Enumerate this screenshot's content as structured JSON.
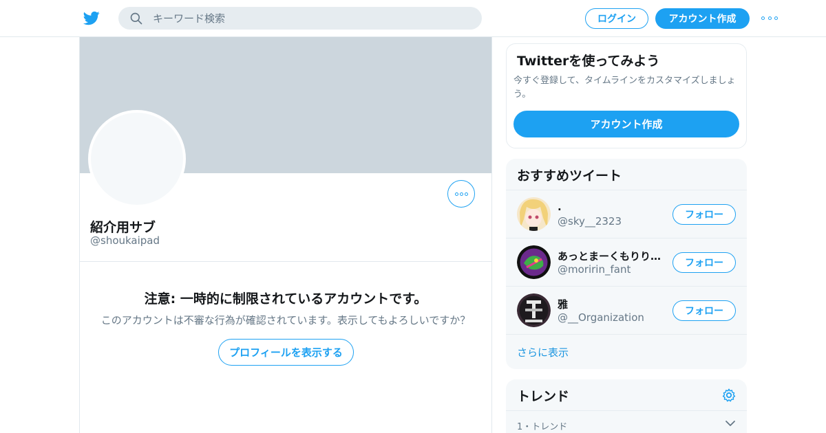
{
  "header": {
    "search_placeholder": "キーワード検索",
    "login_label": "ログイン",
    "signup_label": "アカウント作成"
  },
  "profile": {
    "display_name": "紹介用サブ",
    "handle": "@shoukaipad",
    "warning_title": "注意: 一時的に制限されているアカウントです。",
    "warning_text": "このアカウントは不審な行為が確認されています。表示してもよろしいですか？",
    "show_profile_label": "プロフィールを表示する"
  },
  "signup_card": {
    "title": "Twitterを使ってみよう",
    "description": "今すぐ登録して、タイムラインをカスタマイズしましょう。",
    "button_label": "アカウント作成"
  },
  "recommended": {
    "title": "おすすめツイート",
    "users": [
      {
        "name": ".",
        "handle": "@sky__2323",
        "follow_label": "フォロー"
      },
      {
        "name": "あっとまーくもりりんふぁんと",
        "handle": "@moririn_fant",
        "follow_label": "フォロー"
      },
      {
        "name": "雅",
        "handle": "@__Organization",
        "follow_label": "フォロー"
      }
    ],
    "more_label": "さらに表示"
  },
  "trends": {
    "title": "トレンド",
    "first_meta": "1・トレンド"
  },
  "colors": {
    "accent": "#1da1f2",
    "banner": "#ccd6dd",
    "muted_text": "#657786",
    "card_bg": "#f5f8fa"
  }
}
